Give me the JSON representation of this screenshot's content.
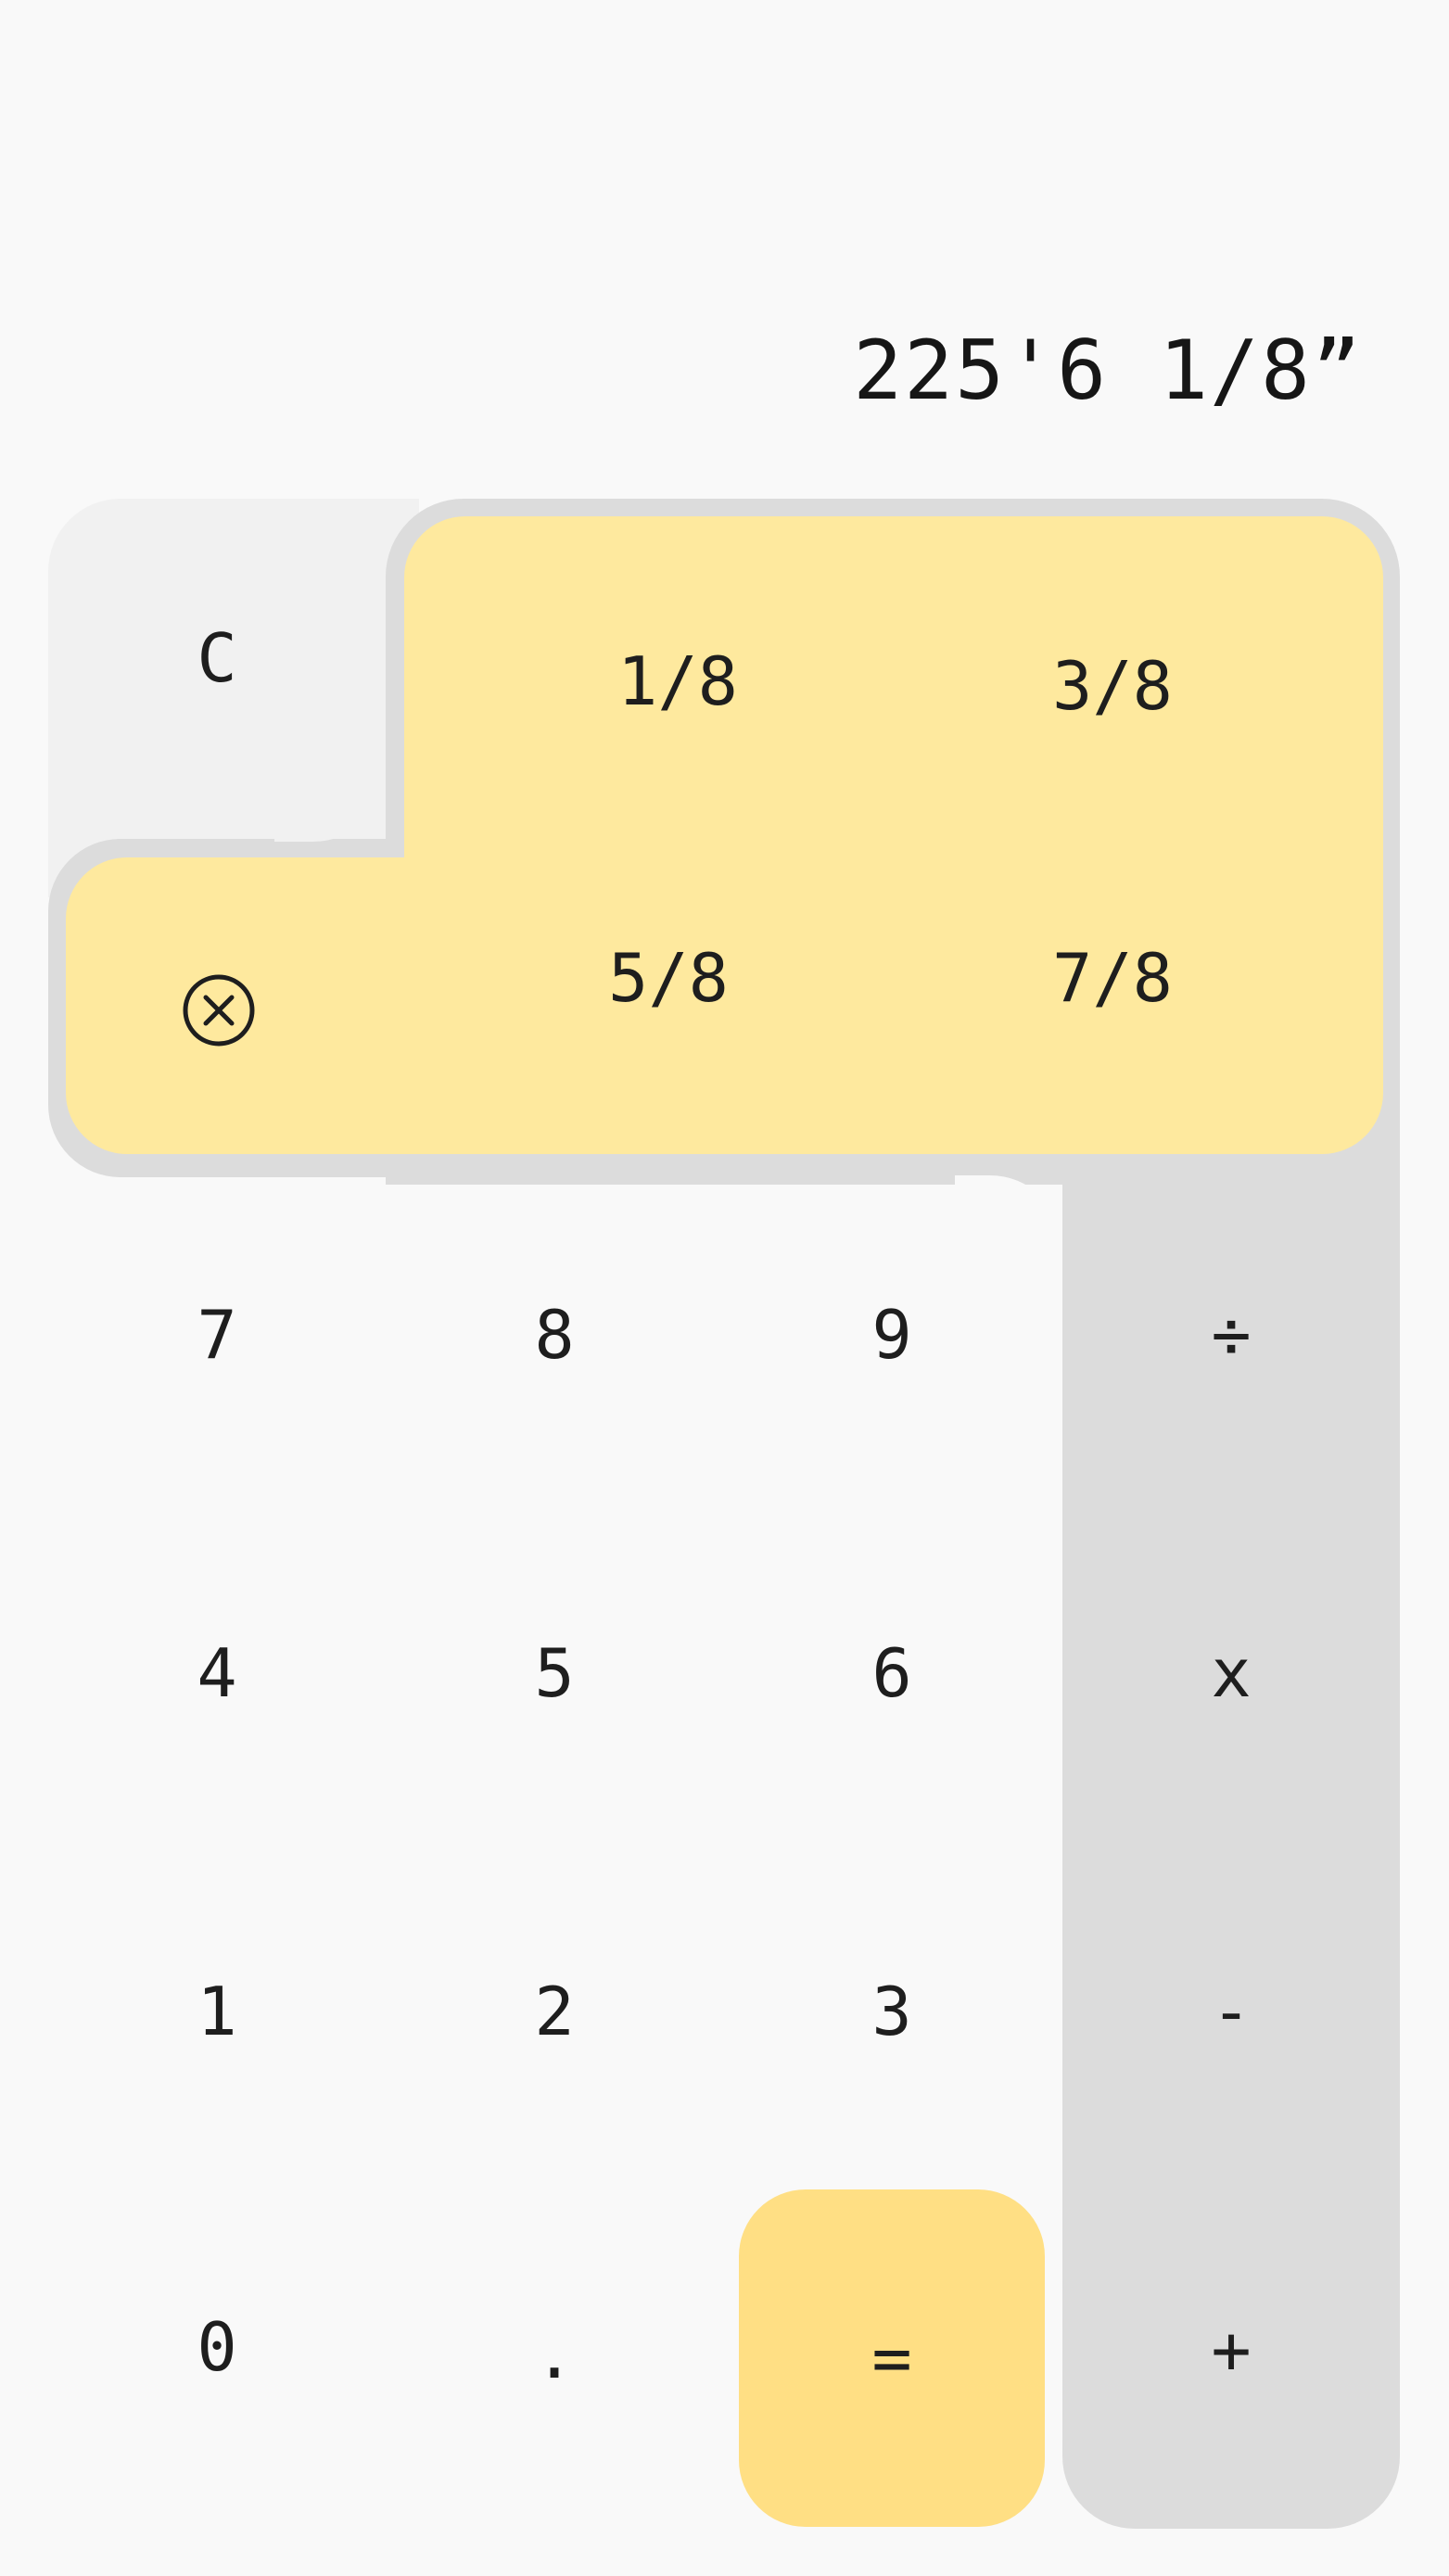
{
  "display": {
    "value": "225'6 1/8”"
  },
  "keys": {
    "clear": "C",
    "backspace_icon": "backspace-circle-icon",
    "fractions": [
      "1/8",
      "3/8",
      "5/8",
      "7/8"
    ],
    "digits_row1": [
      "7",
      "8",
      "9"
    ],
    "digits_row2": [
      "4",
      "5",
      "6"
    ],
    "digits_row3": [
      "1",
      "2",
      "3"
    ],
    "zero": "0",
    "decimal": ".",
    "equals": "=",
    "divide": "÷",
    "multiply": "x",
    "subtract": "-",
    "add": "+"
  },
  "colors": {
    "background": "#f9f9f9",
    "fraction_panel": "#fee99e",
    "operator_column": "#dcdcdc",
    "equals_key": "#ffdf84"
  }
}
